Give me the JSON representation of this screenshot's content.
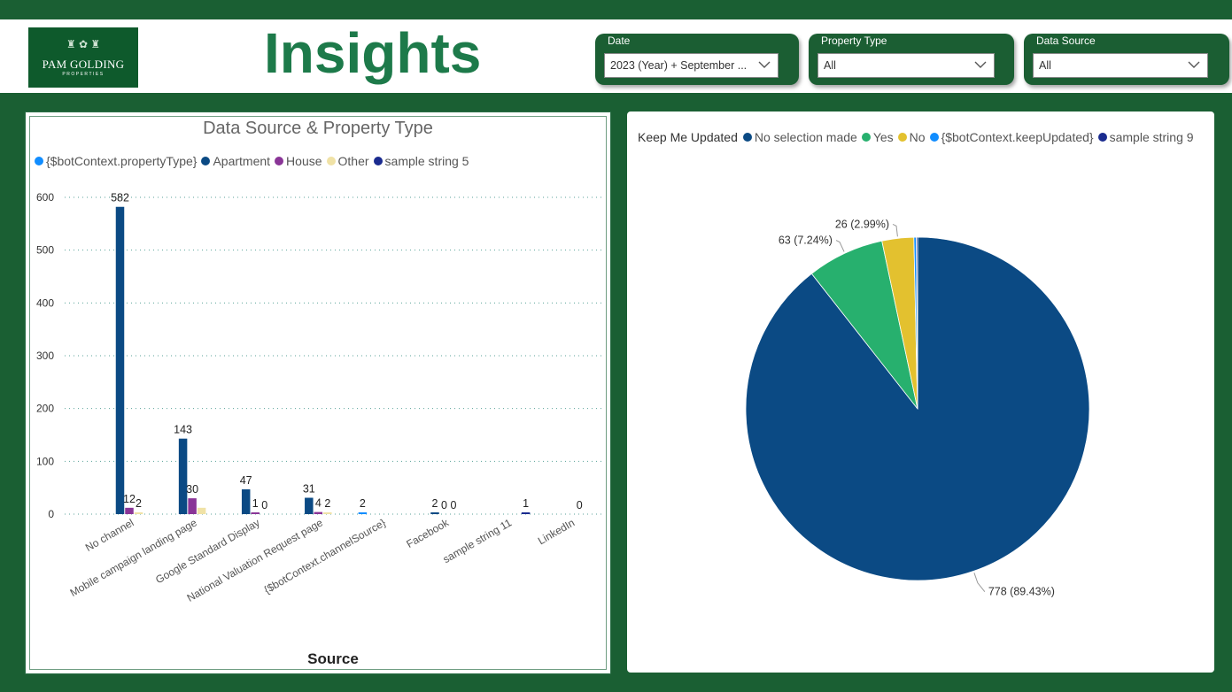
{
  "header": {
    "logo_text": "PAM GOLDING",
    "logo_sub": "PROPERTIES",
    "title": "Insights"
  },
  "slicers": [
    {
      "label": "Date",
      "value": "2023 (Year) + September ..."
    },
    {
      "label": "Property Type",
      "value": "All"
    },
    {
      "label": "Data Source",
      "value": "All"
    }
  ],
  "colors": {
    "brand_green": "#1a5f33",
    "title_green": "#1d7a4a"
  },
  "chart_data": [
    {
      "type": "bar",
      "title": "Data Source & Property Type",
      "xlabel": "Source",
      "ylabel": "",
      "ylim": [
        0,
        620
      ],
      "yticks": [
        0,
        100,
        200,
        300,
        400,
        500,
        600
      ],
      "grid": true,
      "legend_position": "top-left",
      "categories": [
        "No channel",
        "Mobile campaign landing page",
        "Google Standard Display",
        "National Valuation Request page",
        "{$botContext.channelSource}",
        "Facebook",
        "sample string 11",
        "LinkedIn"
      ],
      "series": [
        {
          "name": "{$botContext.propertyType}",
          "color": "#118dff",
          "values": [
            null,
            null,
            null,
            null,
            2,
            null,
            null,
            null
          ],
          "labels": [
            "",
            "",
            "",
            "",
            "2",
            "",
            "",
            ""
          ]
        },
        {
          "name": "Apartment",
          "color": "#0b4a84",
          "values": [
            582,
            143,
            47,
            31,
            null,
            2,
            null,
            null
          ],
          "labels": [
            "582",
            "143",
            "47",
            "31",
            "",
            "2",
            "",
            ""
          ]
        },
        {
          "name": "House",
          "color": "#8a3597",
          "values": [
            12,
            30,
            1,
            4,
            null,
            0,
            null,
            null
          ],
          "labels": [
            "12",
            "30",
            "1",
            "4",
            "",
            "0",
            "",
            ""
          ]
        },
        {
          "name": "Other",
          "color": "#f0e2a6",
          "values": [
            2,
            12,
            0,
            2,
            null,
            0,
            null,
            0
          ],
          "labels": [
            "2",
            "",
            "0",
            "2",
            "",
            "0",
            "",
            "0"
          ]
        },
        {
          "name": "sample string 5",
          "color": "#1a2b8f",
          "values": [
            null,
            null,
            null,
            null,
            null,
            null,
            1,
            null
          ],
          "labels": [
            "",
            "",
            "",
            "",
            "",
            "",
            "1",
            ""
          ]
        }
      ]
    },
    {
      "type": "pie",
      "legend_title": "Keep Me Updated",
      "legend_position": "top",
      "slices": [
        {
          "name": "No selection made",
          "value": 778,
          "label": "778 (89.43%)",
          "color": "#0b4a84"
        },
        {
          "name": "Yes",
          "value": 63,
          "label": "63 (7.24%)",
          "color": "#27b06e"
        },
        {
          "name": "No",
          "value": 26,
          "label": "26 (2.99%)",
          "color": "#e3c12f"
        },
        {
          "name": "{$botContext.keepUpdated}",
          "value": 2,
          "label": "",
          "color": "#118dff"
        },
        {
          "name": "sample string 9",
          "value": 1,
          "label": "",
          "color": "#1a2b8f"
        }
      ]
    }
  ]
}
